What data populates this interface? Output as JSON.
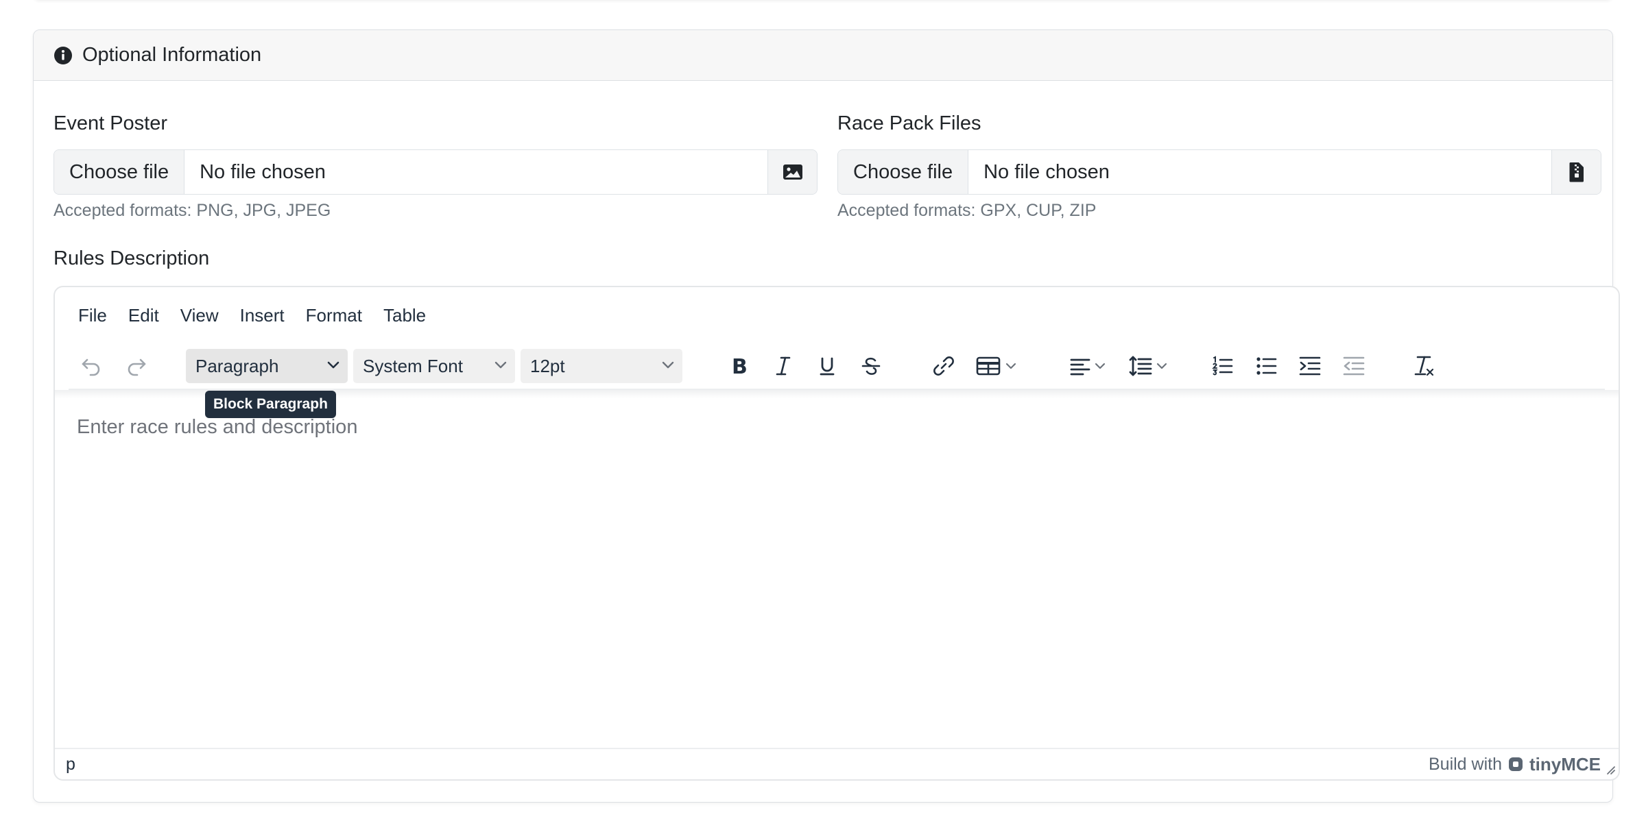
{
  "section": {
    "title": "Optional Information",
    "icon": "info-circle-icon"
  },
  "event_poster": {
    "label": "Event Poster",
    "button_label": "Choose file",
    "file_status": "No file chosen",
    "icon": "image-icon",
    "help": "Accepted formats: PNG, JPG, JPEG"
  },
  "race_pack": {
    "label": "Race Pack Files",
    "button_label": "Choose file",
    "file_status": "No file chosen",
    "icon": "file-zip-icon",
    "help": "Accepted formats: GPX, CUP, ZIP"
  },
  "rules": {
    "label": "Rules Description"
  },
  "editor": {
    "menu": [
      "File",
      "Edit",
      "View",
      "Insert",
      "Format",
      "Table"
    ],
    "block_format": "Paragraph",
    "font_family": "System Font",
    "font_size": "12pt",
    "tooltip": "Block Paragraph",
    "placeholder": "Enter race rules and description",
    "status_path": "p",
    "branding_prefix": "Build with",
    "branding_name": "tinyMCE"
  },
  "colors": {
    "text": "#212529",
    "muted": "#6c757d",
    "toolbar_icon": "#222f3e",
    "tooltip_bg": "#222f3e",
    "card_header_bg": "#f7f7f7"
  }
}
